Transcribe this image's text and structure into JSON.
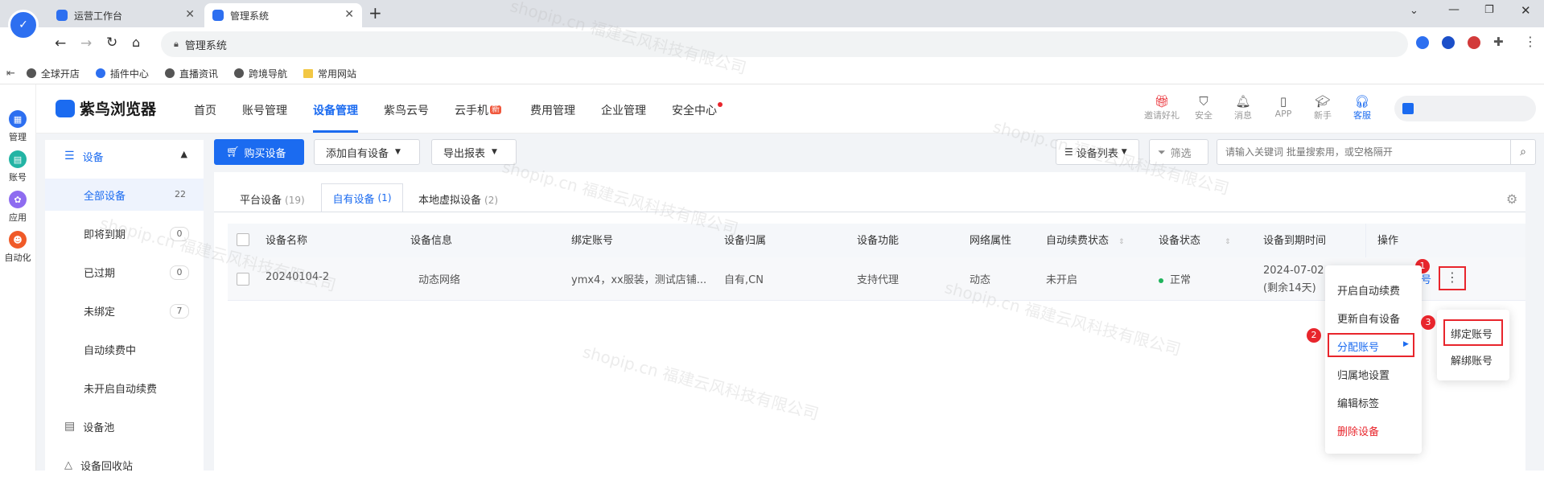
{
  "browser": {
    "tabs": [
      {
        "label": "运营工作台"
      },
      {
        "label": "管理系统"
      }
    ],
    "address": "管理系统",
    "bookmarks": [
      "全球开店",
      "插件中心",
      "直播资讯",
      "跨境导航",
      "常用网站"
    ],
    "watermark": "shopip.cn 福建云风科技有限公司"
  },
  "rail": {
    "items": [
      {
        "label": "管理"
      },
      {
        "label": "账号"
      },
      {
        "label": "应用"
      },
      {
        "label": "自动化"
      }
    ]
  },
  "brand": {
    "name": "紫鸟浏览器"
  },
  "nav": {
    "items": [
      {
        "label": "首页"
      },
      {
        "label": "账号管理"
      },
      {
        "label": "设备管理"
      },
      {
        "label": "紫鸟云号"
      },
      {
        "label": "云手机"
      },
      {
        "label": "费用管理"
      },
      {
        "label": "企业管理"
      },
      {
        "label": "安全中心"
      }
    ],
    "new_badge": "新"
  },
  "topbar": {
    "icons": [
      {
        "label": "邀请好礼",
        "icon": "gift-icon"
      },
      {
        "label": "安全",
        "icon": "shield-icon"
      },
      {
        "label": "消息",
        "icon": "bell-icon"
      },
      {
        "label": "APP",
        "icon": "phone-icon"
      },
      {
        "label": "新手",
        "icon": "graduation-icon"
      },
      {
        "label": "客服",
        "icon": "headset-icon"
      }
    ]
  },
  "sidebar": {
    "section": "设备",
    "items": [
      {
        "label": "全部设备",
        "count": "22"
      },
      {
        "label": "即将到期",
        "count": "0"
      },
      {
        "label": "已过期",
        "count": "0"
      },
      {
        "label": "未绑定",
        "count": "7"
      },
      {
        "label": "自动续费中",
        "count": ""
      },
      {
        "label": "未开启自动续费",
        "count": ""
      }
    ],
    "pool": "设备池",
    "recycle": "设备回收站"
  },
  "toolbar": {
    "buy": "购买设备",
    "add": "添加自有设备",
    "export": "导出报表",
    "list": "设备列表",
    "filter": "筛选",
    "search_placeholder": "请输入关键词 批量搜索用，或空格隔开"
  },
  "tabs": [
    {
      "label": "平台设备",
      "count": "(19)"
    },
    {
      "label": "自有设备",
      "count": "(1)"
    },
    {
      "label": "本地虚拟设备",
      "count": "(2)"
    }
  ],
  "table": {
    "headers": [
      "设备名称",
      "设备信息",
      "绑定账号",
      "设备归属",
      "设备功能",
      "网络属性",
      "自动续费状态",
      "设备状态",
      "设备到期时间",
      "操作"
    ],
    "row": {
      "name": "20240104-2",
      "info": "动态网络",
      "accounts": "ymx4，xx服装，测试店铺...",
      "owner": "自有,CN",
      "function": "支持代理",
      "network": "动态",
      "autorenew": "未开启",
      "status": "正常",
      "expire": "2024-07-02",
      "remain": "(剩余14天)",
      "op_partial": "号"
    }
  },
  "menu": {
    "items": [
      "开启自动续费",
      "更新自有设备",
      "分配账号",
      "归属地设置",
      "编辑标签",
      "删除设备"
    ]
  },
  "submenu": {
    "items": [
      "绑定账号",
      "解绑账号"
    ]
  },
  "steps": [
    "1",
    "2",
    "3"
  ],
  "colors": {
    "accent": "#1b6bf0",
    "danger": "#e8252c",
    "success": "#1fb35b"
  }
}
